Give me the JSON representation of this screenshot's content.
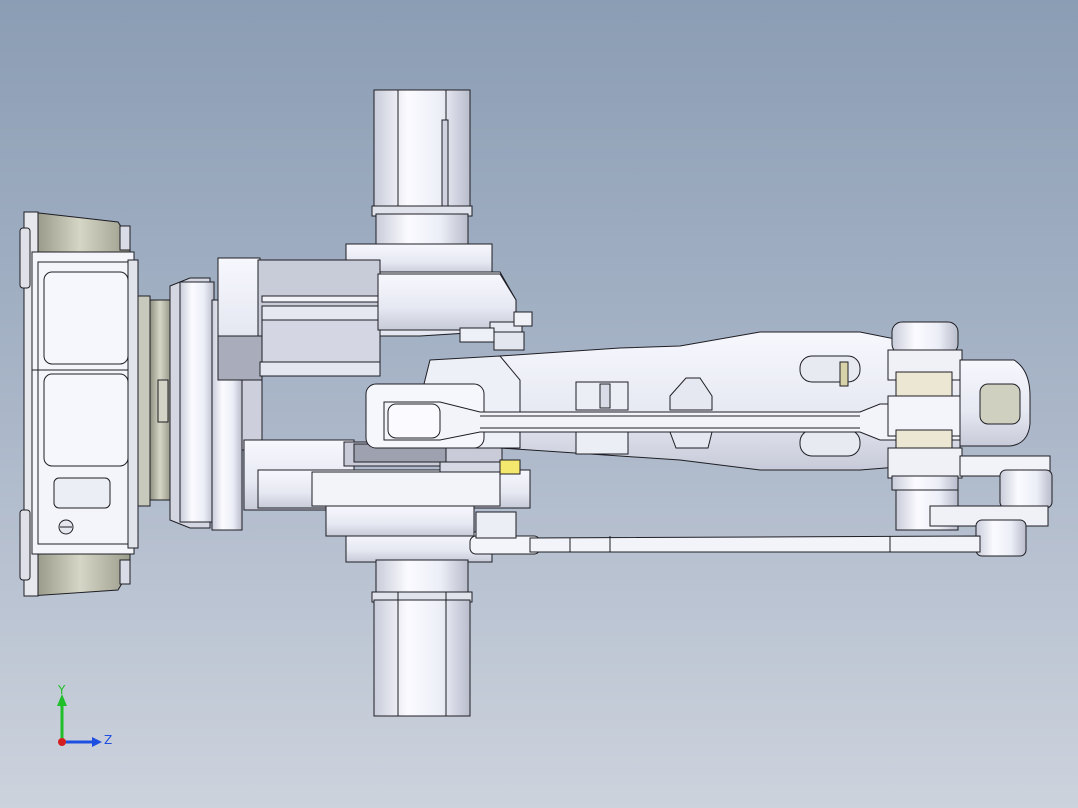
{
  "viewport": {
    "background_top": "#8b9db4",
    "background_bottom": "#cdd3dd"
  },
  "model": {
    "fill_light": "#f4f5fb",
    "fill_mid": "#d9dbe8",
    "fill_dark": "#a9adbb",
    "fill_accent": "#ebe7d2",
    "edge_color": "#1e1e24"
  },
  "triad": {
    "y_label": "Y",
    "z_label": "Z",
    "y_color": "#1fbf2a",
    "z_color": "#1f4fe0",
    "x_color": "#d42020"
  }
}
